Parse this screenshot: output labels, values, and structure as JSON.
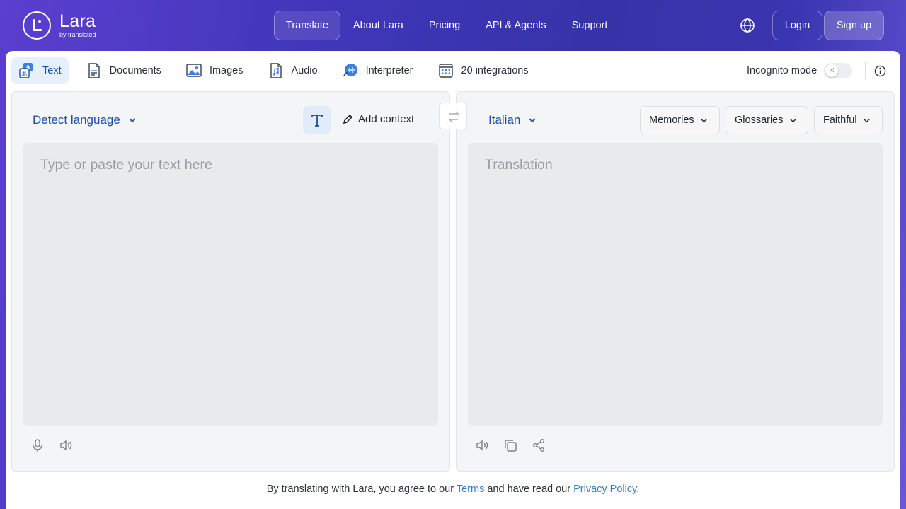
{
  "brand": {
    "name": "Lara",
    "sub": "by translated"
  },
  "nav": {
    "items": [
      "Translate",
      "About Lara",
      "Pricing",
      "API & Agents",
      "Support"
    ],
    "active": "Translate"
  },
  "auth": {
    "login": "Login",
    "signup": "Sign up"
  },
  "tabs": [
    "Text",
    "Documents",
    "Images",
    "Audio",
    "Interpreter",
    "20 integrations"
  ],
  "incognito": {
    "label": "Incognito mode",
    "enabled": false
  },
  "source": {
    "language": "Detect language",
    "add_context": "Add context",
    "placeholder": "Type or paste your text here"
  },
  "target": {
    "language": "Italian",
    "memories": "Memories",
    "glossaries": "Glossaries",
    "style": "Faithful",
    "placeholder": "Translation"
  },
  "footer": {
    "prefix": "By translating with Lara, you agree to our",
    "terms": "Terms",
    "middle": "and have read our",
    "privacy": "Privacy Policy",
    "suffix": "."
  },
  "colors": {
    "accent": "#1b4fa8",
    "link": "#2f7fd1",
    "header_bg": "#3f36b8"
  }
}
